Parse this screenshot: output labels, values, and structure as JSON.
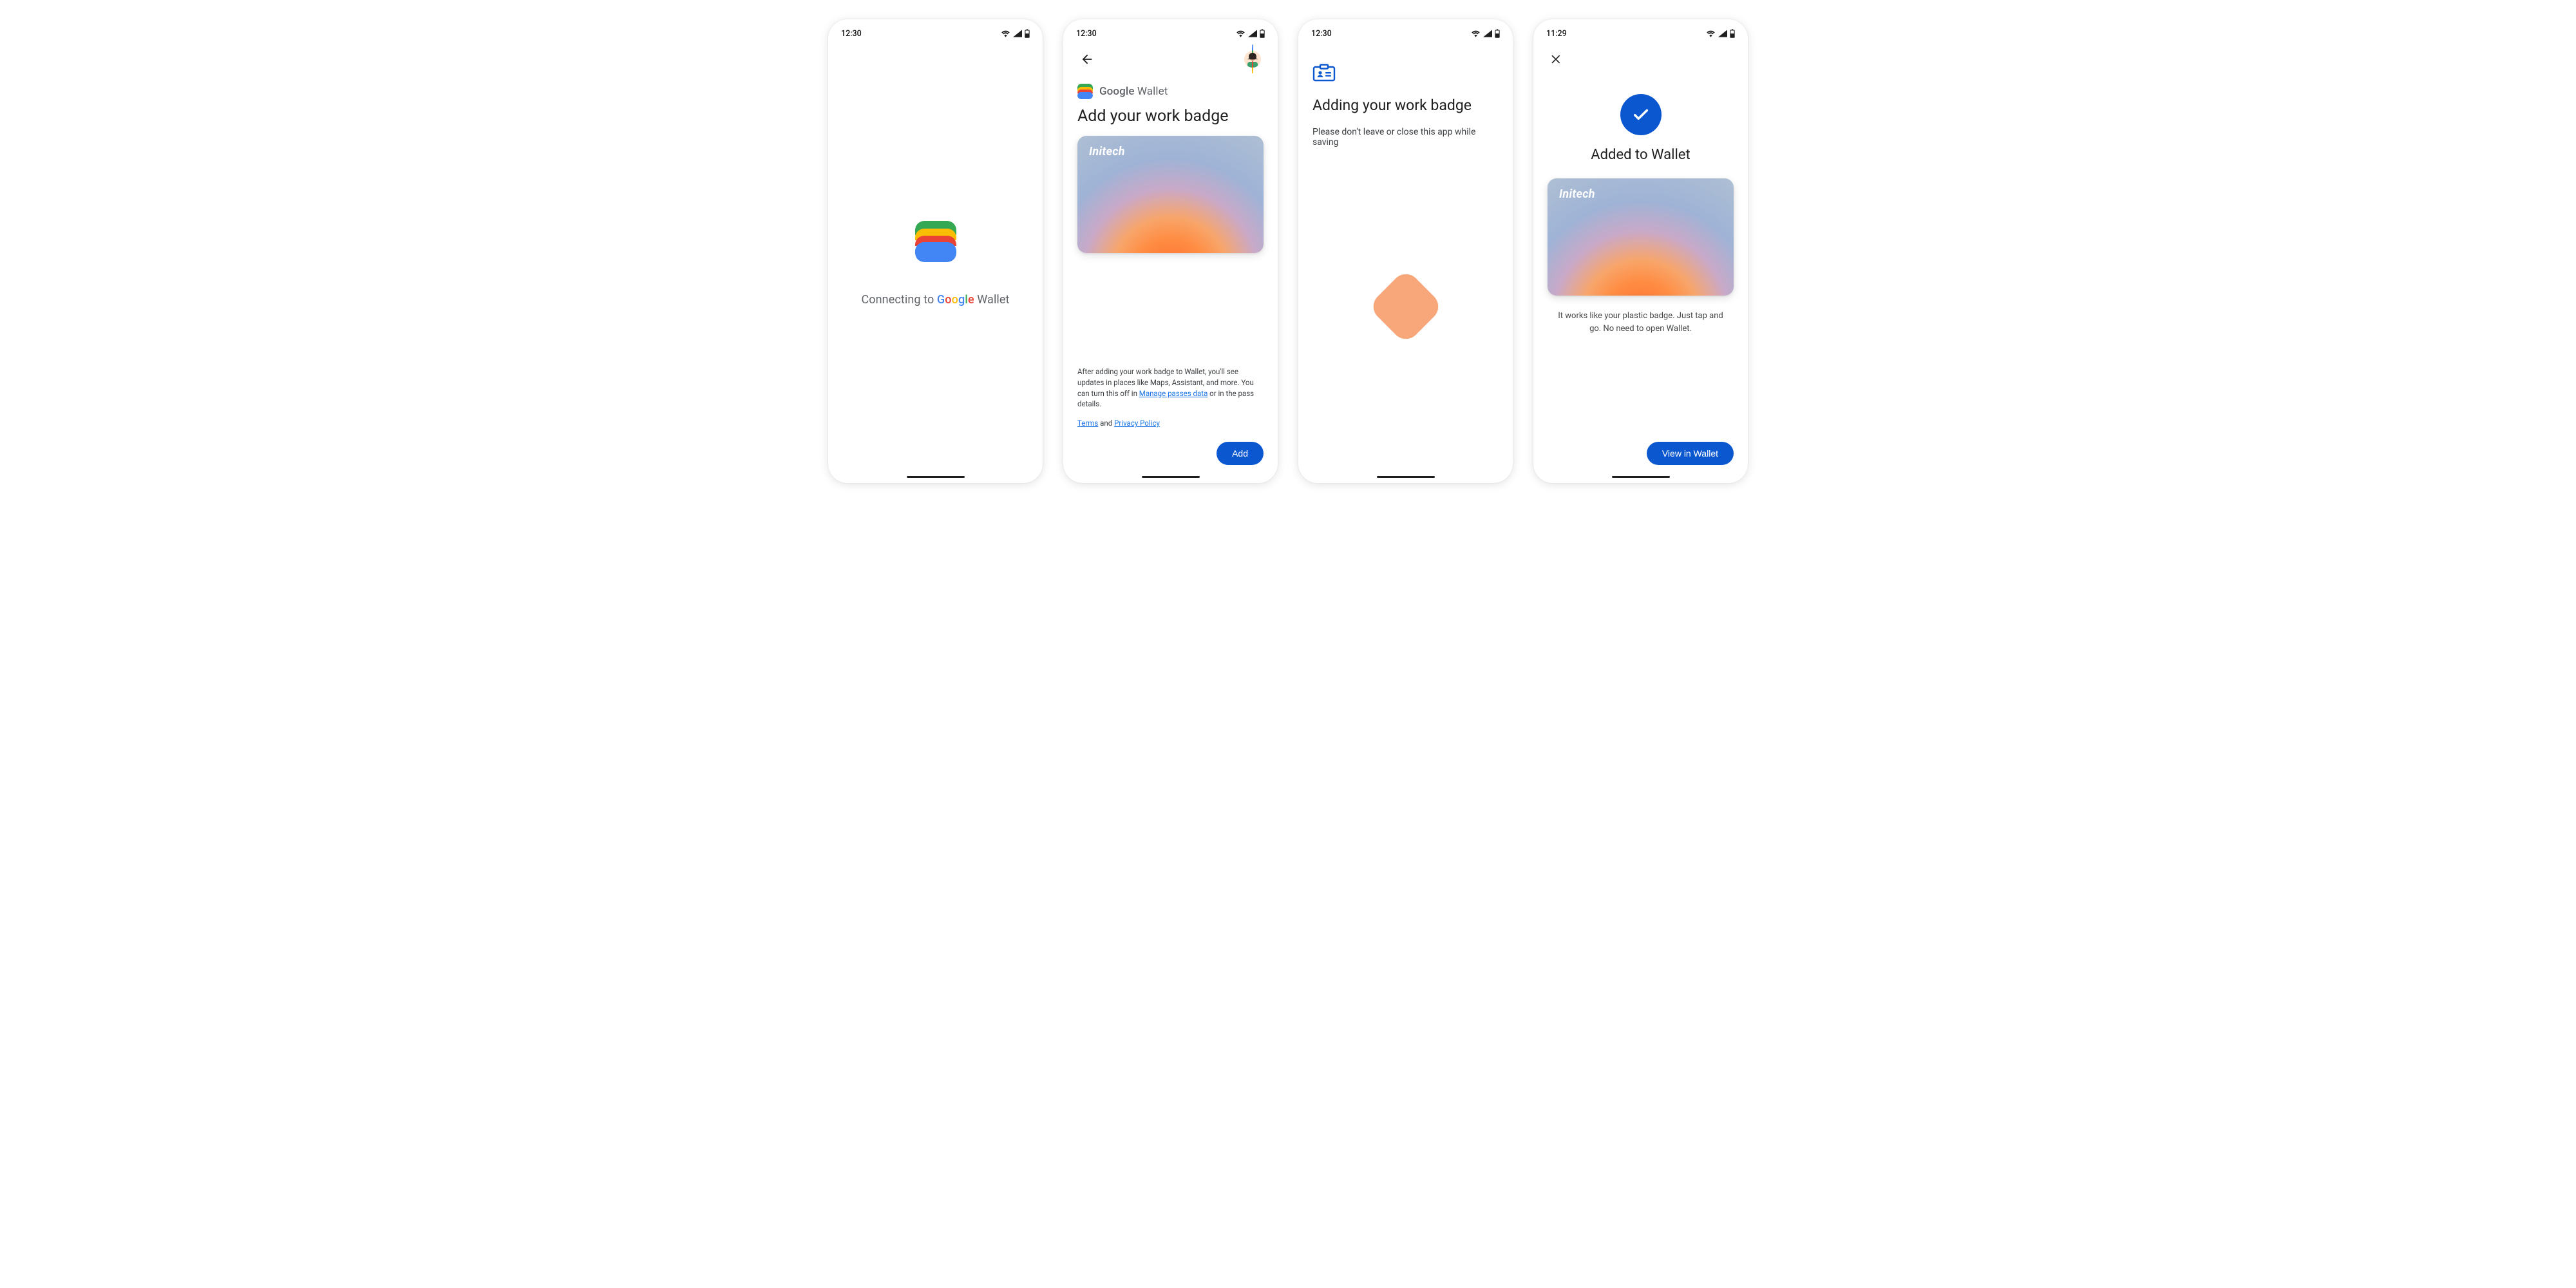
{
  "status": {
    "s1_time": "12:30",
    "s2_time": "12:30",
    "s3_time": "12:30",
    "s4_time": "11:29"
  },
  "screen1": {
    "connecting_prefix": "Connecting to ",
    "connecting_suffix": " Wallet",
    "google": "Google"
  },
  "screen2": {
    "back_label": "Back",
    "wallet_google": "Google",
    "wallet_word": " Wallet",
    "title": "Add your work badge",
    "card_brand": "Initech",
    "disclosure_before": "After adding your work badge to Wallet, you'll see updates in places like Maps, Assistant, and more. You can turn this off in ",
    "disclosure_link": "Manage passes data",
    "disclosure_after": " or in the pass details.",
    "terms_link": "Terms",
    "terms_and": " and ",
    "privacy_link": "Privacy Policy",
    "add_button": "Add"
  },
  "screen3": {
    "title": "Adding your work badge",
    "subtitle": "Please don't leave or close this app while saving"
  },
  "screen4": {
    "close_label": "Close",
    "title": "Added to Wallet",
    "card_brand": "Initech",
    "desc": "It works like your plastic badge. Just tap and go. No need to open Wallet.",
    "view_button": "View in Wallet"
  }
}
